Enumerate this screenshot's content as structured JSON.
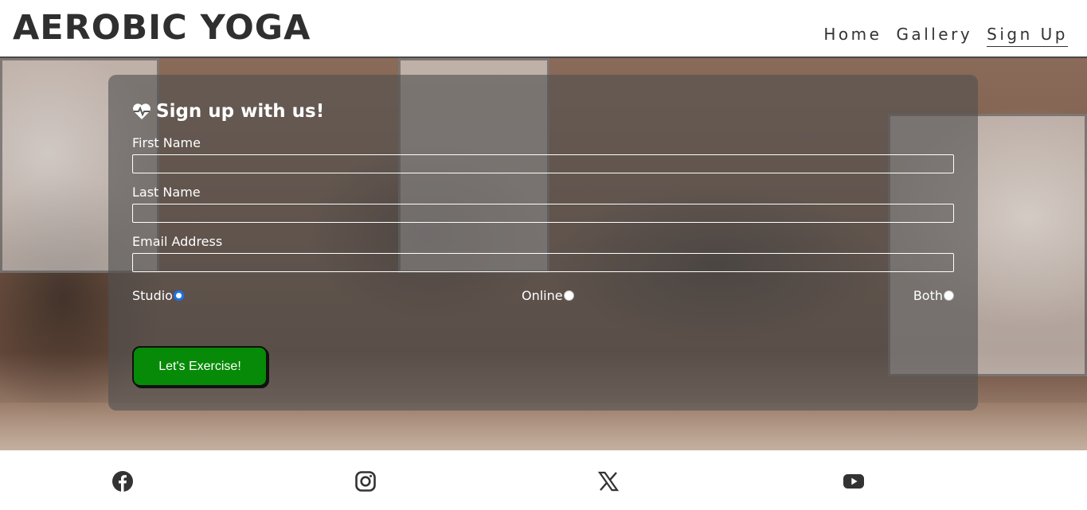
{
  "header": {
    "logo": "AEROBIC YOGA",
    "nav": [
      {
        "label": "Home"
      },
      {
        "label": "Gallery"
      },
      {
        "label": "Sign Up"
      }
    ]
  },
  "form": {
    "title": "Sign up with us!",
    "title_icon": "heart-pulse-icon",
    "fields": [
      {
        "label": "First Name",
        "value": "",
        "placeholder": ""
      },
      {
        "label": "Last Name",
        "value": "",
        "placeholder": ""
      },
      {
        "label": "Email Address",
        "value": "",
        "placeholder": ""
      }
    ],
    "options": [
      {
        "label": "Studio",
        "checked": true
      },
      {
        "label": "Online",
        "checked": false
      },
      {
        "label": "Both",
        "checked": false
      }
    ],
    "submit_label": "Let's Exercise!",
    "submit_color": "#078a07"
  },
  "footer": {
    "icons": [
      "facebook-icon",
      "instagram-icon",
      "x-icon",
      "youtube-icon"
    ]
  }
}
